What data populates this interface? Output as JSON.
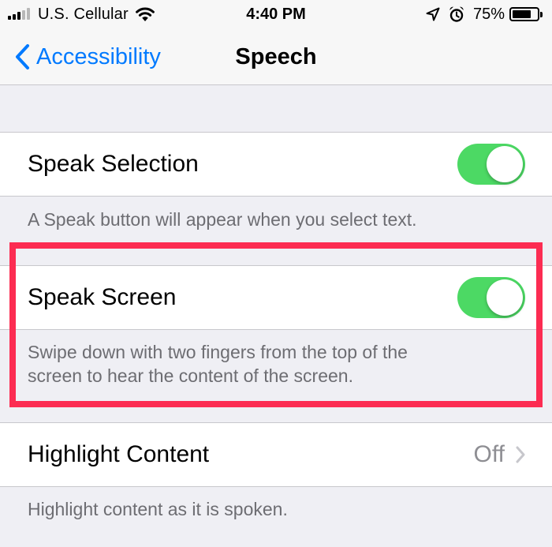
{
  "status_bar": {
    "carrier": "U.S. Cellular",
    "time": "4:40 PM",
    "battery_percent": "75%",
    "battery_level": 0.75,
    "signal_bars_filled": 3,
    "signal_bars_total": 5,
    "icons": [
      "cellular-signal-icon",
      "wifi-icon",
      "location-arrow-icon",
      "alarm-clock-icon",
      "battery-icon"
    ]
  },
  "nav": {
    "back_label": "Accessibility",
    "title": "Speech",
    "back_icon": "chevron-left-icon"
  },
  "settings": {
    "speak_selection": {
      "label": "Speak Selection",
      "enabled": true,
      "footer": "A Speak button will appear when you select text."
    },
    "speak_screen": {
      "label": "Speak Screen",
      "enabled": true,
      "footer_line1": "Swipe down with two fingers from the top of the",
      "footer_line2": "screen to hear the content of the screen."
    },
    "highlight_content": {
      "label": "Highlight Content",
      "value": "Off",
      "footer": "Highlight content as it is spoken."
    }
  },
  "colors": {
    "accent": "#007aff",
    "toggle_on": "#4cd964",
    "highlight_outline": "#fc2c52",
    "group_background": "#efeff4",
    "footer_text": "#6d6d72",
    "secondary_value": "#8e8e93"
  }
}
